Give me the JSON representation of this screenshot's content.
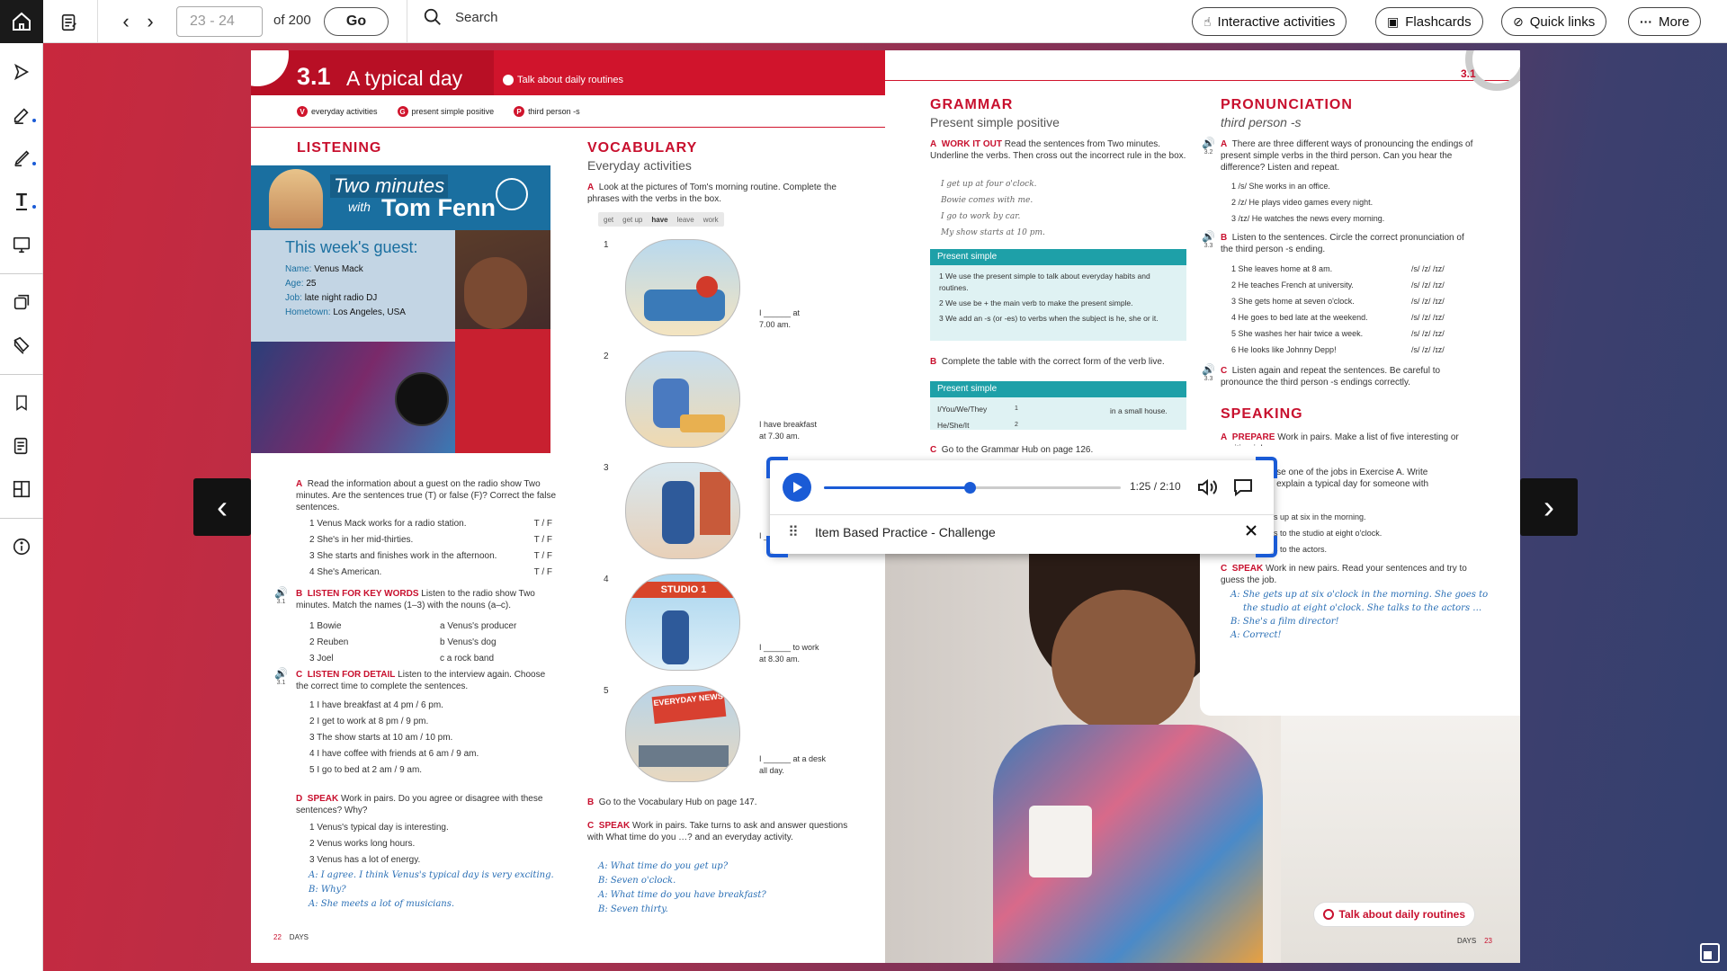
{
  "toolbar": {
    "page_range_placeholder": "23 - 24",
    "of_pages": "of 200",
    "go_label": "Go",
    "search_label": "Search",
    "interactive_label": "Interactive activities",
    "flashcards_label": "Flashcards",
    "quicklinks_label": "Quick links",
    "more_label": "More"
  },
  "sidebar": {
    "items": [
      "home-icon",
      "notes-icon",
      "pointer-icon",
      "pen-edit-icon",
      "highlighter-icon",
      "text-tool-icon",
      "whiteboard-icon",
      "interactive-icon",
      "resources-icon",
      "bookmark-icon",
      "notes-list-icon",
      "layout-icon",
      "info-icon"
    ]
  },
  "left_page": {
    "unit": "3.1",
    "title": "A typical day",
    "objective": "Talk about daily routines",
    "tags": [
      {
        "letter": "V",
        "text": "everyday activities"
      },
      {
        "letter": "G",
        "text": "present simple positive"
      },
      {
        "letter": "P",
        "text": "third person -s"
      }
    ],
    "listening_head": "LISTENING",
    "vocab_head": "VOCABULARY",
    "vocab_sub": "Everyday activities",
    "poster": {
      "title1": "Two minutes",
      "title2": "with",
      "title3": "Tom Fenn",
      "guest": "This week's guest:",
      "rows": [
        {
          "k": "Name:",
          "v": "Venus Mack"
        },
        {
          "k": "Age:",
          "v": "25"
        },
        {
          "k": "Job:",
          "v": "late night radio DJ"
        },
        {
          "k": "Hometown:",
          "v": "Los Angeles, USA"
        }
      ]
    },
    "ex_a_lbl": "A",
    "ex_a": "Read the information about a guest on the radio show Two minutes. Are the sentences true (T) or false (F)? Correct the false sentences.",
    "ex_a_items": [
      "1  Venus Mack works for a radio station.",
      "2  She's in her mid-thirties.",
      "3  She starts and finishes work in the afternoon.",
      "4  She's American."
    ],
    "tf": "T / F",
    "ex_b_lbl": "B",
    "ex_b_key": "LISTEN FOR KEY WORDS",
    "ex_b": "Listen to the radio show Two minutes. Match the names (1–3) with the nouns (a–c).",
    "audio_ref": "3.1",
    "ex_b_items": [
      "1  Bowie",
      "2  Reuben",
      "3  Joel"
    ],
    "ex_b_nouns": [
      "a  Venus's producer",
      "b  Venus's dog",
      "c  a rock band"
    ],
    "ex_c_lbl": "C",
    "ex_c_key": "LISTEN FOR DETAIL",
    "ex_c": "Listen to the interview again. Choose the correct time to complete the sentences.",
    "ex_c_items": [
      "1  I have breakfast at 4 pm / 6 pm.",
      "2  I get to work at 8 pm / 9 pm.",
      "3  The show starts at 10 am / 10 pm.",
      "4  I have coffee with friends at 6 am / 9 am.",
      "5  I go to bed at 2 am / 9 am."
    ],
    "ex_d_lbl": "D",
    "ex_d_key": "SPEAK",
    "ex_d": "Work in pairs. Do you agree or disagree with these sentences? Why?",
    "ex_d_items": [
      "1  Venus's typical day is interesting.",
      "2  Venus works long hours.",
      "3  Venus has a lot of energy."
    ],
    "ex_d_hand": [
      "A: I agree. I think Venus's typical day is very exciting.",
      "B: Why?",
      "A: She meets a lot of musicians."
    ],
    "vocab_a_lbl": "A",
    "vocab_a": "Look at the pictures of Tom's morning routine. Complete the phrases with the verbs in the box.",
    "verbs": [
      "get",
      "get up",
      "have",
      "leave",
      "work"
    ],
    "pics": [
      {
        "n": "1",
        "t": "I ______ at",
        "t2": "7.00 am."
      },
      {
        "n": "2",
        "t": "I  have  breakfast",
        "t2": "at 7.30 am."
      },
      {
        "n": "3",
        "t": "I ______",
        "t2": ""
      },
      {
        "n": "4",
        "t": "I ______ to work",
        "t2": "at 8.30 am."
      },
      {
        "n": "5",
        "t": "I ______ at a desk",
        "t2": "all day."
      }
    ],
    "studio_sign": "STUDIO 1",
    "news_sign": "EVERYDAY NEWS",
    "vocab_b": "Go to the Vocabulary Hub on page 147.",
    "vocab_b_lbl": "B",
    "vocab_c_lbl": "C",
    "vocab_c_key": "SPEAK",
    "vocab_c": "Work in pairs. Take turns to ask and answer questions with What time do you …? and an everyday activity.",
    "vocab_c_hand": [
      "A: What time do you get up?",
      "B: Seven o'clock.",
      "A: What time do you have breakfast?",
      "B: Seven thirty."
    ],
    "footer_num": "22",
    "footer_txt": "DAYS"
  },
  "right_page": {
    "unit": "3.1",
    "grammar_head": "GRAMMAR",
    "grammar_sub": "Present simple positive",
    "gram_a_lbl": "A",
    "gram_a_key": "WORK IT OUT",
    "gram_a": "Read the sentences from Two minutes. Underline the verbs. Then cross out the incorrect rule in the box.",
    "gram_a_items": [
      "I get up at four o'clock.",
      "Bowie comes with me.",
      "I go to work by car.",
      "My show starts at 10 pm."
    ],
    "ps_title": "Present simple",
    "ps_rules": [
      "1  We use the present simple to talk about everyday habits and routines.",
      "2  We use be + the main verb to make the present simple.",
      "3  We add an -s (or -es) to verbs when the subject is he, she or it."
    ],
    "gram_b_lbl": "B",
    "gram_b": "Complete the table with the correct form of the verb live.",
    "table_title": "Present simple",
    "table_rows": [
      "I/You/We/They",
      "He/She/It"
    ],
    "table_nums": [
      "1",
      "2"
    ],
    "table_tail": "in a small house.",
    "gram_c_lbl": "C",
    "gram_c": "Go to the Grammar Hub on page 126.",
    "pron_head": "PRONUNCIATION",
    "pron_sub": "third person -s",
    "pron_a_lbl": "A",
    "pron_a": "There are three different ways of pronouncing the endings of present simple verbs in the third person. Can you hear the difference? Listen and repeat.",
    "audio_a": "3.2",
    "pron_a_items": [
      "1  /s/  She works in an office.",
      "2  /z/  He plays video games every night.",
      "3  /ɪz/  He watches the news every morning."
    ],
    "pron_b_lbl": "B",
    "pron_b": "Listen to the sentences. Circle the correct pronunciation of the third person -s ending.",
    "audio_b": "3.3",
    "pron_b_items": [
      "1  She leaves home at 8 am.",
      "2  He teaches French at university.",
      "3  She gets home at seven o'clock.",
      "4  He goes to bed late at the weekend.",
      "5  She washes her hair twice a week.",
      "6  He looks like Johnny Depp!"
    ],
    "pron_opts": "/s/  /z/  /ɪz/",
    "pron_c_lbl": "C",
    "pron_c": "Listen again and repeat the sentences. Be careful to pronounce the third person -s endings correctly.",
    "audio_c": "3.3",
    "speak_head": "SPEAKING",
    "sp_a_lbl": "A",
    "sp_a_key": "PREPARE",
    "sp_a": "Work in pairs. Make a list of five interesting or exciting jobs.",
    "sp_b_frag": [
      "oose one of the jobs in Exercise A. Write",
      "to explain a typical day for someone with"
    ],
    "sp_b_frag2": [
      "s up at six in the morning.",
      "s to the studio at eight o'clock.",
      "s to the actors."
    ],
    "sp_c_lbl": "C",
    "sp_c_key": "SPEAK",
    "sp_c": "Work in new pairs. Read your sentences and try to guess the job.",
    "sp_c_hand": [
      "A: She gets up at six o'clock in the morning. She goes to",
      "the studio at eight o'clock. She talks to the actors …",
      "B: She's a film director!",
      "A: Correct!"
    ],
    "objective_pill": "Talk about daily routines",
    "footer_txt": "DAYS",
    "footer_num": "23"
  },
  "player": {
    "time": "1:25 / 2:10",
    "progress": 0.49,
    "title": "Item Based Practice - Challenge"
  },
  "colors": {
    "brand_red": "#d0142c",
    "player_blue": "#1a5bd6",
    "teal": "#1ea0a8"
  }
}
